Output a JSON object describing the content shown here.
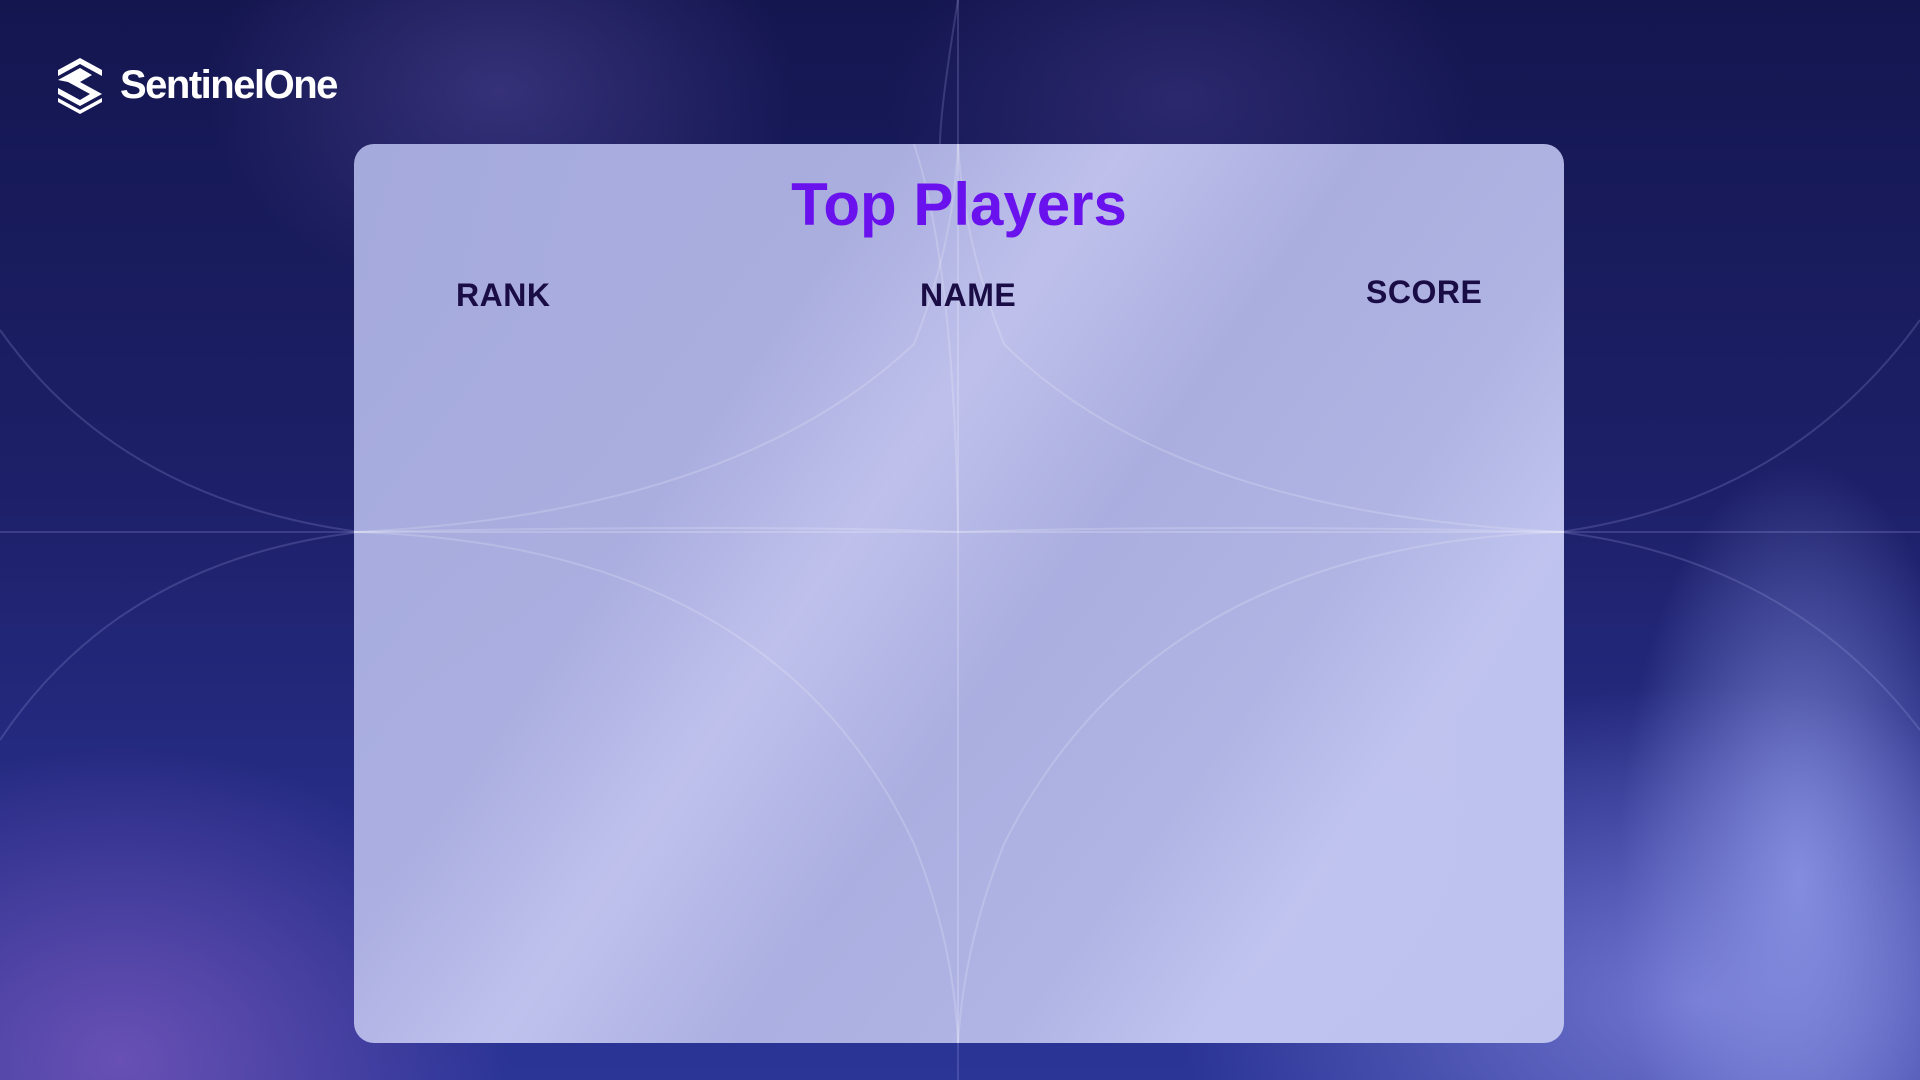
{
  "brand": {
    "name": "SentinelOne",
    "logo_icon": "sentinelone-logo-icon"
  },
  "leaderboard": {
    "title": "Top Players",
    "columns": [
      "RANK",
      "NAME",
      "SCORE"
    ],
    "rows": []
  },
  "colors": {
    "title": "#6a12ee",
    "header_text": "#1a0d45",
    "background_dark": "#141650",
    "panel": "#b4b7e4"
  }
}
